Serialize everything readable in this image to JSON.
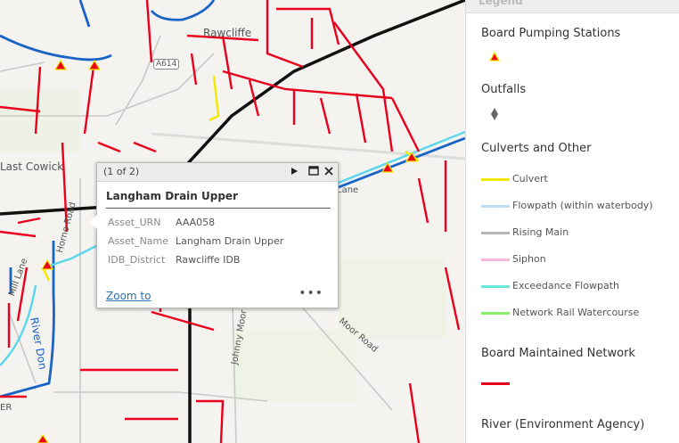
{
  "map": {
    "place_labels": [
      "Rawcliffe",
      "Last Cowick",
      "A614",
      "River Don",
      "Moor Road",
      "Johnny Moor",
      "Mill Lane",
      "Horne Road",
      "Lane",
      "ER"
    ]
  },
  "popup": {
    "pager": "(1 of 2)",
    "title": "Langham Drain Upper",
    "fields": [
      {
        "key": "Asset_URN",
        "value": "AAA058"
      },
      {
        "key": "Asset_Name",
        "value": "Langham Drain Upper"
      },
      {
        "key": "IDB_District",
        "value": "Rawcliffe IDB"
      }
    ],
    "zoom_link": "Zoom to",
    "more": "•••"
  },
  "legend": {
    "header": "Legend",
    "sections": {
      "pumping": "Board Pumping Stations",
      "outfalls": "Outfalls",
      "culverts": "Culverts and Other",
      "network": "Board Maintained Network",
      "river": "River (Environment Agency)"
    },
    "items": [
      {
        "label": "Culvert",
        "color": "#f2e800"
      },
      {
        "label": "Flowpath (within waterbody)",
        "color": "#bde0f4"
      },
      {
        "label": "Rising Main",
        "color": "#b5b5b5"
      },
      {
        "label": "Siphon",
        "color": "#f7b8da"
      },
      {
        "label": "Exceedance Flowpath",
        "color": "#6be8d6"
      },
      {
        "label": "Network Rail Watercourse",
        "color": "#8af06a"
      }
    ],
    "network_color": "#e8001c"
  }
}
